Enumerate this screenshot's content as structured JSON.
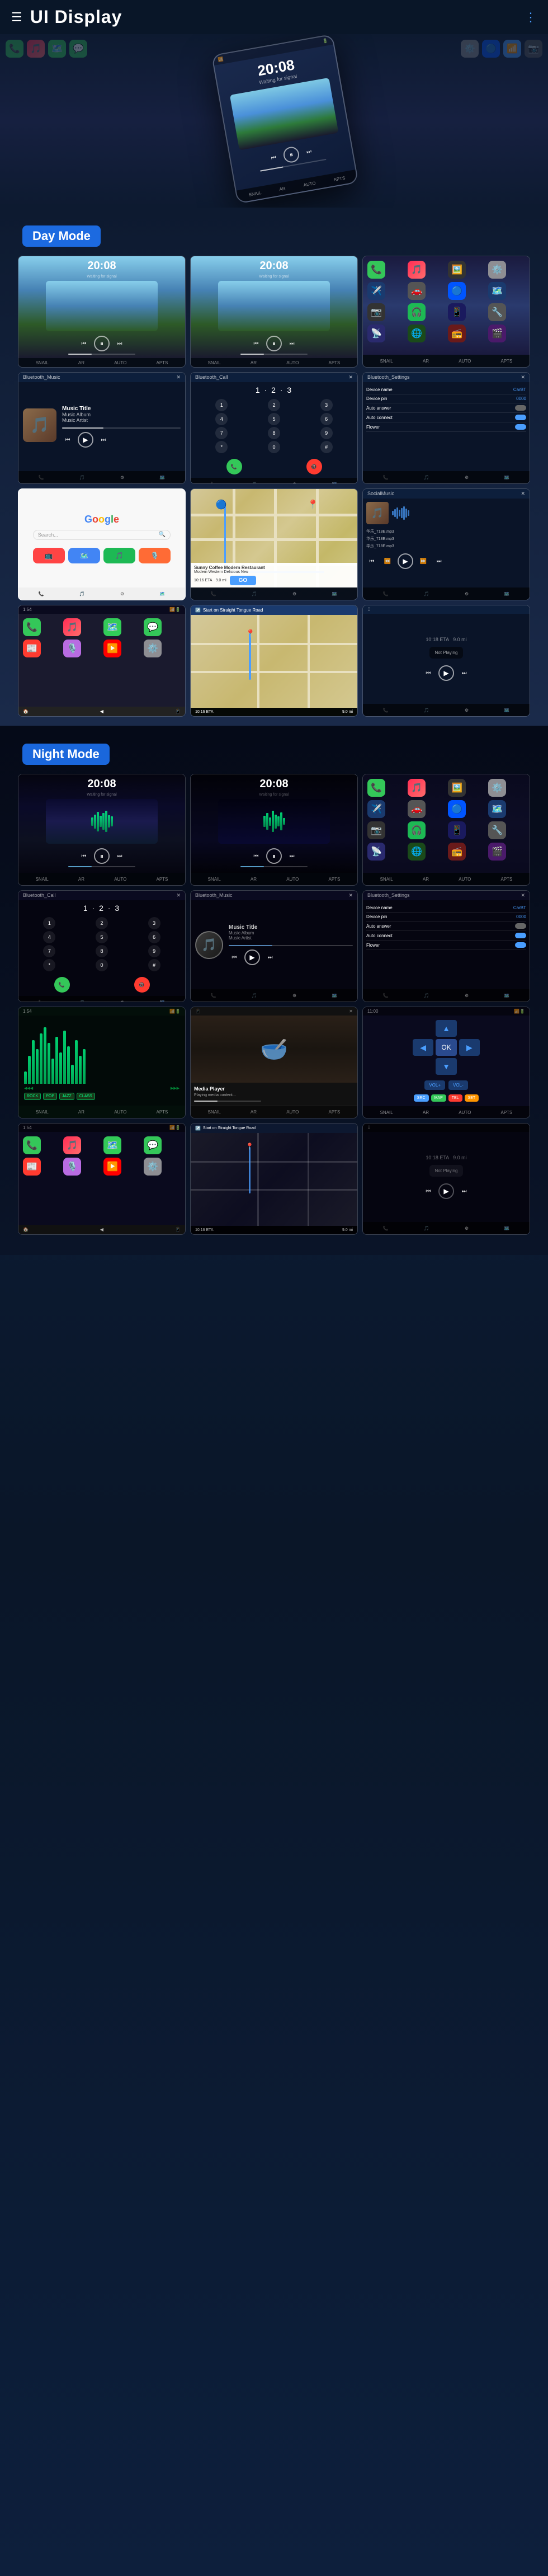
{
  "header": {
    "title": "UI Display",
    "menu_icon": "≡",
    "nav_icon": "⋮"
  },
  "day_mode": {
    "label": "Day Mode"
  },
  "night_mode": {
    "label": "Night Mode"
  },
  "screens": {
    "time": "20:08",
    "time_sub": "Waiting for signal",
    "bt_music": "Bluetooth_Music",
    "bt_call": "Bluetooth_Call",
    "bt_settings": "Bluetooth_Settings",
    "music_title": "Music Title",
    "music_album": "Music Album",
    "music_artist": "Music Artist",
    "device_name_label": "Device name",
    "device_name_val": "CarBT",
    "device_pin_label": "Device pin",
    "device_pin_val": "0000",
    "auto_answer_label": "Auto answer",
    "auto_connect_label": "Auto connect",
    "flower_label": "Flower",
    "social_music": "SocialMusic",
    "google_label": "Google",
    "map_label": "Map",
    "sunny_coffee": "Sunny Coffee Modern Restaurant",
    "sunny_address": "Modern Western Delicious Neu",
    "eta_label": "10:16 ETA",
    "distance_label": "9.0 mi",
    "go_label": "GO",
    "not_playing": "Not Playing",
    "nav_direction": "Start on Straight Tongue Road",
    "nav_street": "Straight Tongue Road",
    "file1": "华乐_718E.mp3",
    "file2": "华乐_718E.mp3",
    "file3": "华乐_718E.mp3"
  },
  "bottom_nav": {
    "items": [
      "SNAIL",
      "AR",
      "AUTO",
      "⚙"
    ]
  },
  "bottom_nav2": {
    "items": [
      "SNAIL",
      "AR",
      "AUTO",
      "APTS"
    ]
  }
}
